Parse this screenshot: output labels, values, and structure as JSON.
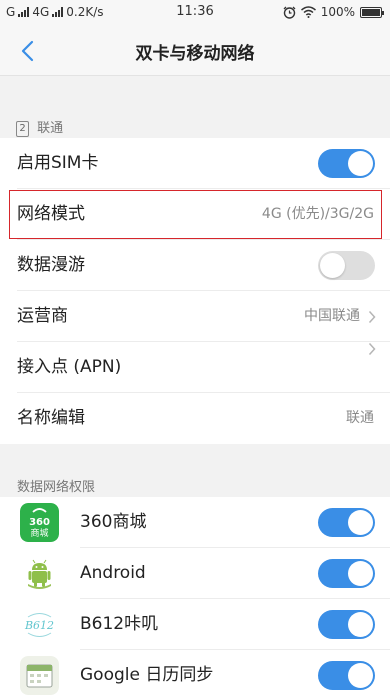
{
  "status_bar": {
    "carrier1": "G",
    "carrier2": "4G",
    "speed": "0.2K/s",
    "time": "11:36",
    "battery": "100%",
    "icons": [
      "signal-icon",
      "alarm-icon",
      "wifi-icon",
      "battery-icon"
    ]
  },
  "nav": {
    "title": "双卡与移动网络",
    "back_icon": "chevron-left-icon"
  },
  "sim_section": {
    "sim_number": "2",
    "header": "联通",
    "rows": [
      {
        "label": "启用SIM卡",
        "toggle": true
      },
      {
        "label": "网络模式",
        "value": "4G (优先)/3G/2G",
        "highlighted": true
      },
      {
        "label": "数据漫游",
        "toggle": false
      },
      {
        "label": "运营商",
        "value": "中国联通",
        "arrow": true
      },
      {
        "label": "接入点 (APN)",
        "arrow": true
      },
      {
        "label": "名称编辑",
        "value": "联通"
      }
    ]
  },
  "data_section": {
    "header": "数据网络权限",
    "apps": [
      {
        "label": "360商城",
        "icon": "360-store-icon",
        "icon_text1": "360",
        "icon_text2": "商城",
        "toggle": true
      },
      {
        "label": "Android",
        "icon": "android-icon",
        "toggle": true
      },
      {
        "label": "B612咔叽",
        "icon": "b612-icon",
        "icon_text": "B612",
        "toggle": true
      },
      {
        "label": "Google 日历同步",
        "icon": "calendar-sync-icon",
        "toggle": true
      }
    ]
  },
  "colors": {
    "accent": "#3a8ee6",
    "highlight": "#d6262b",
    "toggle_off": "#dedede"
  }
}
